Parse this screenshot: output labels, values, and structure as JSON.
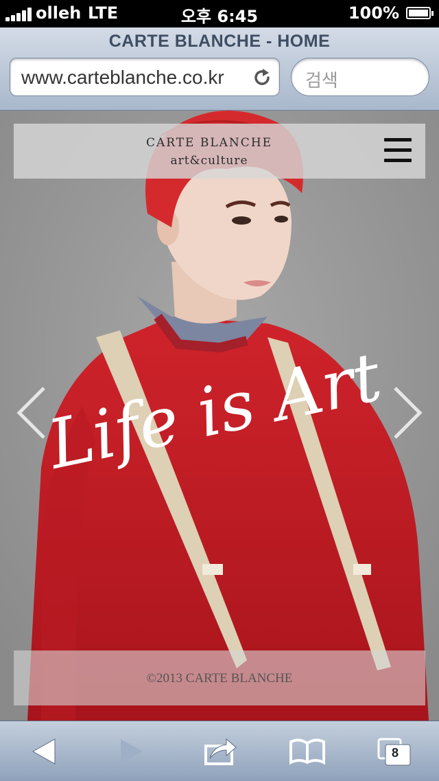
{
  "status_bar": {
    "carrier": "olleh",
    "network": "LTE",
    "time": "오후 6:45",
    "battery": "100%"
  },
  "browser": {
    "page_title": "CARTE BLANCHE - HOME",
    "url": "www.carteblanche.co.kr",
    "search_placeholder": "검색",
    "tab_count": "8"
  },
  "site": {
    "brand": "CARTE BLANCHE",
    "tagline": "art&culture",
    "hero_text": "Life is Art",
    "copyright": "©2013 CARTE BLANCHE"
  },
  "colors": {
    "sweater": "#c41d26",
    "hair": "#d42a2d",
    "backdrop": "#999999"
  },
  "icons": [
    "signal-icon",
    "battery-icon",
    "reload-icon",
    "menu-icon",
    "chevron-left-icon",
    "chevron-right-icon",
    "back-icon",
    "forward-icon",
    "share-icon",
    "bookmarks-icon",
    "tabs-icon"
  ]
}
